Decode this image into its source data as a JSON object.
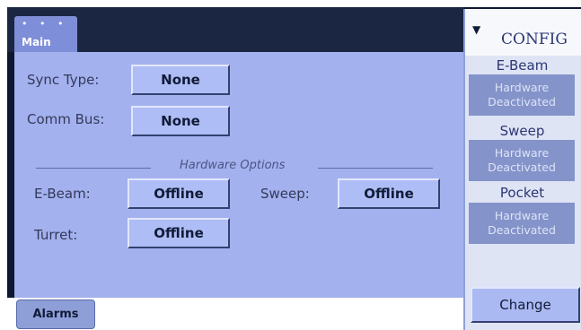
{
  "header": {
    "tab_dots": "• • •",
    "tab_label": "Main"
  },
  "main": {
    "sync_type": {
      "label": "Sync Type:",
      "value": "None"
    },
    "comm_bus": {
      "label": "Comm Bus:",
      "value": "None"
    },
    "hardware_options_title": "Hardware Options",
    "ebeam": {
      "label": "E-Beam:",
      "value": "Offline"
    },
    "sweep": {
      "label": "Sweep:",
      "value": "Offline"
    },
    "turret": {
      "label": "Turret:",
      "value": "Offline"
    }
  },
  "footer": {
    "alarms_label": "Alarms"
  },
  "config_panel": {
    "dropdown_icon": "▼",
    "title": "CONFIG",
    "sections": [
      {
        "name": "E-Beam",
        "status_line1": "Hardware",
        "status_line2": "Deactivated"
      },
      {
        "name": "Sweep",
        "status_line1": "Hardware",
        "status_line2": "Deactivated"
      },
      {
        "name": "Pocket",
        "status_line1": "Hardware",
        "status_line2": "Deactivated"
      }
    ],
    "change_label": "Change"
  },
  "colors": {
    "panel_bg": "#a3b1ee",
    "button_bg": "#afbdf6",
    "hw_box_bg": "#8493c9",
    "top_bar": "#1b2742",
    "config_text": "#2c3674"
  }
}
